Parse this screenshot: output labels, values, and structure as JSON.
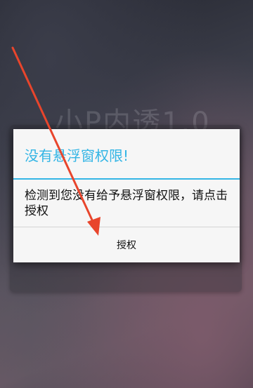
{
  "background": {
    "app_title": "小P内透1.0"
  },
  "dialog": {
    "title": "没有悬浮窗权限!",
    "message": "检测到您没有给予悬浮窗权限，请点击授权",
    "button_label": "授权"
  },
  "colors": {
    "accent": "#33b5e5",
    "annotation_arrow": "#e8452c"
  },
  "icons": {
    "annotation": "red-arrow-icon"
  }
}
